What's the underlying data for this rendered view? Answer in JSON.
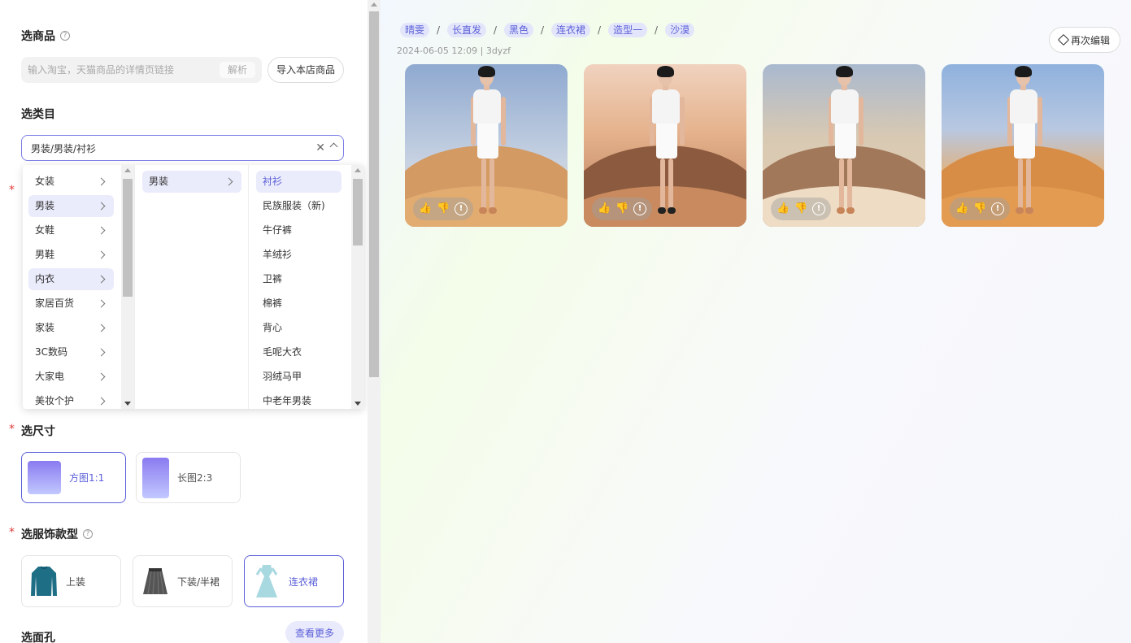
{
  "product": {
    "title": "选商品",
    "link_placeholder": "输入淘宝，天猫商品的详情页链接",
    "parse_label": "解析",
    "import_label": "导入本店商品"
  },
  "category": {
    "title": "选类目",
    "selected": "男装/男装/衬衫",
    "level1": [
      "女装",
      "男装",
      "女鞋",
      "男鞋",
      "内衣",
      "家居百货",
      "家装",
      "3C数码",
      "大家电",
      "美妆个护"
    ],
    "level2": [
      "男装"
    ],
    "level3": [
      "衬衫",
      "民族服装（新)",
      "牛仔裤",
      "羊绒衫",
      "卫裤",
      "棉裤",
      "背心",
      "毛呢大衣",
      "羽绒马甲",
      "中老年男装"
    ]
  },
  "size": {
    "title": "选尺寸",
    "options": [
      {
        "label": "方图1:1",
        "active": true
      },
      {
        "label": "长图2:3",
        "active": false
      }
    ]
  },
  "garment": {
    "title": "选服饰款型",
    "options": [
      {
        "label": "上装",
        "icon": "top-garment-icon"
      },
      {
        "label": "下装/半裙",
        "icon": "pleated-skirt-icon"
      },
      {
        "label": "连衣裙",
        "icon": "dress-icon"
      }
    ]
  },
  "face": {
    "title": "选面孔",
    "more_label": "查看更多"
  },
  "result": {
    "tags": [
      "晴雯",
      "长直发",
      "黑色",
      "连衣裙",
      "造型一",
      "沙漠"
    ],
    "separator": "/",
    "meta": "2024-06-05 12:09 | 3dyzf",
    "re_edit_label": "再次编辑",
    "image_count": 4,
    "action_like": "👍",
    "action_dislike": "👎",
    "action_info": "!"
  },
  "colors": {
    "accent": "#5b5fd8",
    "tag_bg": "#e3e6fa",
    "required": "#e03c3c"
  }
}
